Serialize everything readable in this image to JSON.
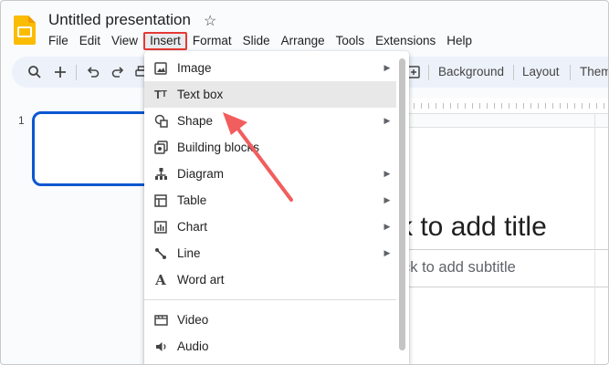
{
  "app": {
    "title": "Untitled presentation",
    "star_icon": "star-icon",
    "logo_icon": "slides-logo-icon"
  },
  "menubar": {
    "items": [
      "File",
      "Edit",
      "View",
      "Insert",
      "Format",
      "Slide",
      "Arrange",
      "Tools",
      "Extensions",
      "Help"
    ],
    "active": "Insert"
  },
  "toolbar": {
    "search_icon": "search-icon",
    "add_icon": "plus-icon",
    "undo_icon": "undo-icon",
    "redo_icon": "redo-icon",
    "print_icon": "print-icon",
    "background_label": "Background",
    "layout_label": "Layout",
    "theme_label": "Theme"
  },
  "filmstrip": {
    "slide_number": "1"
  },
  "slide": {
    "title_placeholder": "k to add title",
    "subtitle_placeholder": "ck to add subtitle"
  },
  "insert_menu": {
    "items": [
      {
        "label": "Image",
        "icon": "image-icon",
        "submenu": true
      },
      {
        "label": "Text box",
        "icon": "text-box-icon",
        "submenu": false
      },
      {
        "label": "Shape",
        "icon": "shape-icon",
        "submenu": true
      },
      {
        "label": "Building blocks",
        "icon": "building-blocks-icon",
        "submenu": false
      },
      {
        "label": "Diagram",
        "icon": "diagram-icon",
        "submenu": true
      },
      {
        "label": "Table",
        "icon": "table-icon",
        "submenu": true
      },
      {
        "label": "Chart",
        "icon": "chart-icon",
        "submenu": true
      },
      {
        "label": "Line",
        "icon": "line-icon",
        "submenu": true
      },
      {
        "label": "Word art",
        "icon": "word-art-icon",
        "submenu": false
      },
      {
        "label": "Video",
        "icon": "video-icon",
        "submenu": false
      },
      {
        "label": "Audio",
        "icon": "audio-icon",
        "submenu": false
      }
    ],
    "highlighted": "Text box"
  },
  "colors": {
    "accent_blue": "#0b57d0",
    "highlight_red": "#e53935",
    "annotation_arrow": "#f25d5d",
    "logo_yellow": "#fbbc04"
  }
}
